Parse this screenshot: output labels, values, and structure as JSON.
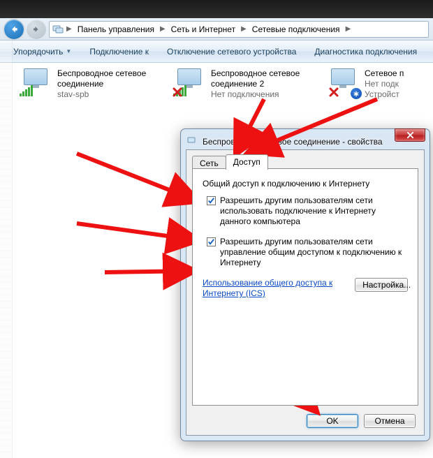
{
  "breadcrumb": {
    "seg1": "Панель управления",
    "seg2": "Сеть и Интернет",
    "seg3": "Сетевые подключения"
  },
  "toolbar": {
    "organize": "Упорядочить",
    "connect": "Подключение к",
    "disable": "Отключение сетевого устройства",
    "diagnose": "Диагностика подключения"
  },
  "connections": [
    {
      "title": "Беспроводное сетевое соединение",
      "sub": "stav-spb",
      "state": "ok"
    },
    {
      "title": "Беспроводное сетевое соединение 2",
      "sub": "Нет подключения",
      "state": "x"
    },
    {
      "title": "Сетевое п",
      "sub": "Нет подк",
      "sub2": "Устройст",
      "state": "bt"
    }
  ],
  "dialog": {
    "title": "Беспроводное сетевое соединение - свойства",
    "tabs": {
      "net": "Сеть",
      "access": "Доступ"
    },
    "group_title": "Общий доступ к подключению к Интернету",
    "chk1": "Разрешить другим пользователям сети использовать подключение к Интернету данного компьютера",
    "chk2": "Разрешить другим пользователям сети управление общим доступом к подключению к Интернету",
    "link": "Использование общего доступа к Интернету (ICS)",
    "settings_btn": "Настройка...",
    "ok": "OK",
    "cancel": "Отмена"
  }
}
